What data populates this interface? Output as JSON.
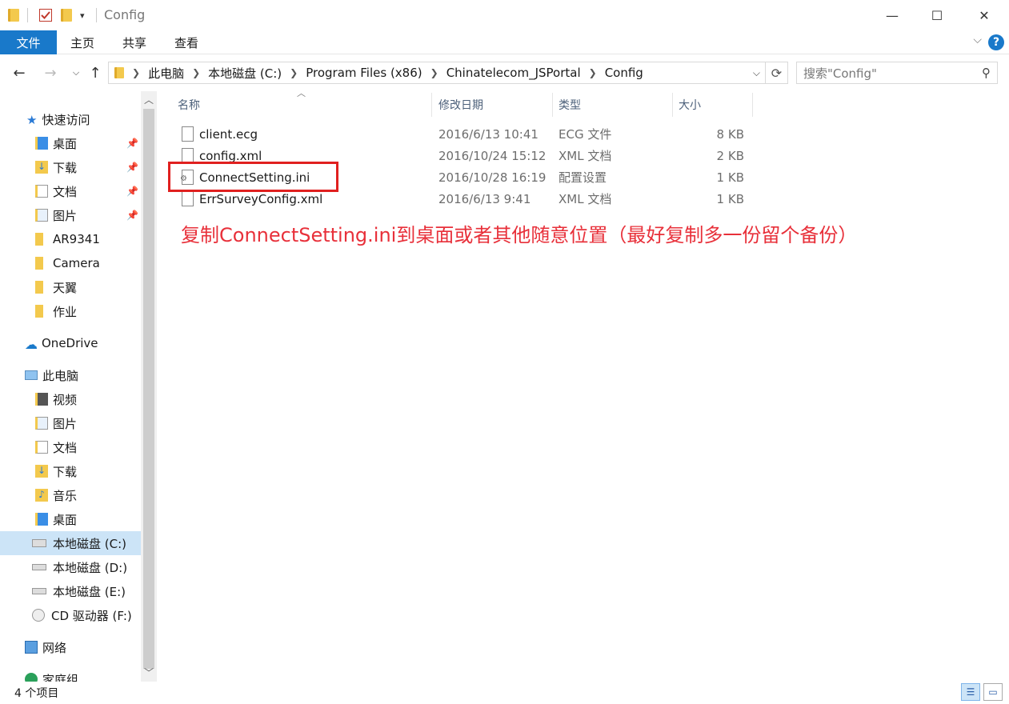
{
  "window": {
    "title": "Config",
    "minimize": "—",
    "maximize": "☐",
    "close": "✕"
  },
  "ribbon": {
    "tabs": [
      "文件",
      "主页",
      "共享",
      "查看"
    ],
    "help": "?"
  },
  "address": {
    "crumbs": [
      "此电脑",
      "本地磁盘 (C:)",
      "Program Files (x86)",
      "Chinatelecom_JSPortal",
      "Config"
    ],
    "search_placeholder": "搜索\"Config\""
  },
  "nav_pane": {
    "quick_access": "快速访问",
    "pinned": [
      "桌面",
      "下载",
      "文档",
      "图片"
    ],
    "folders": [
      "AR9341",
      "Camera",
      "天翼",
      "作业"
    ],
    "onedrive": "OneDrive",
    "this_pc": "此电脑",
    "pc_items": [
      "视频",
      "图片",
      "文档",
      "下载",
      "音乐",
      "桌面"
    ],
    "drives": [
      "本地磁盘 (C:)",
      "本地磁盘 (D:)",
      "本地磁盘 (E:)",
      "CD 驱动器 (F:)"
    ],
    "network": "网络",
    "homegroup": "家庭组"
  },
  "columns": {
    "name": "名称",
    "date": "修改日期",
    "type": "类型",
    "size": "大小"
  },
  "files": [
    {
      "name": "client.ecg",
      "date": "2016/6/13 10:41",
      "type": "ECG 文件",
      "size": "8 KB"
    },
    {
      "name": "config.xml",
      "date": "2016/10/24 15:12",
      "type": "XML 文档",
      "size": "2 KB"
    },
    {
      "name": "ConnectSetting.ini",
      "date": "2016/10/28 16:19",
      "type": "配置设置",
      "size": "1 KB"
    },
    {
      "name": "ErrSurveyConfig.xml",
      "date": "2016/6/13 9:41",
      "type": "XML 文档",
      "size": "1 KB"
    }
  ],
  "annotation": "复制ConnectSetting.ini到桌面或者其他随意位置（最好复制多一份留个备份）",
  "status": {
    "item_count": "4 个项目"
  },
  "colors": {
    "accent": "#1979ca",
    "annotation": "#e8303a",
    "highlight_box": "#e0201f"
  }
}
